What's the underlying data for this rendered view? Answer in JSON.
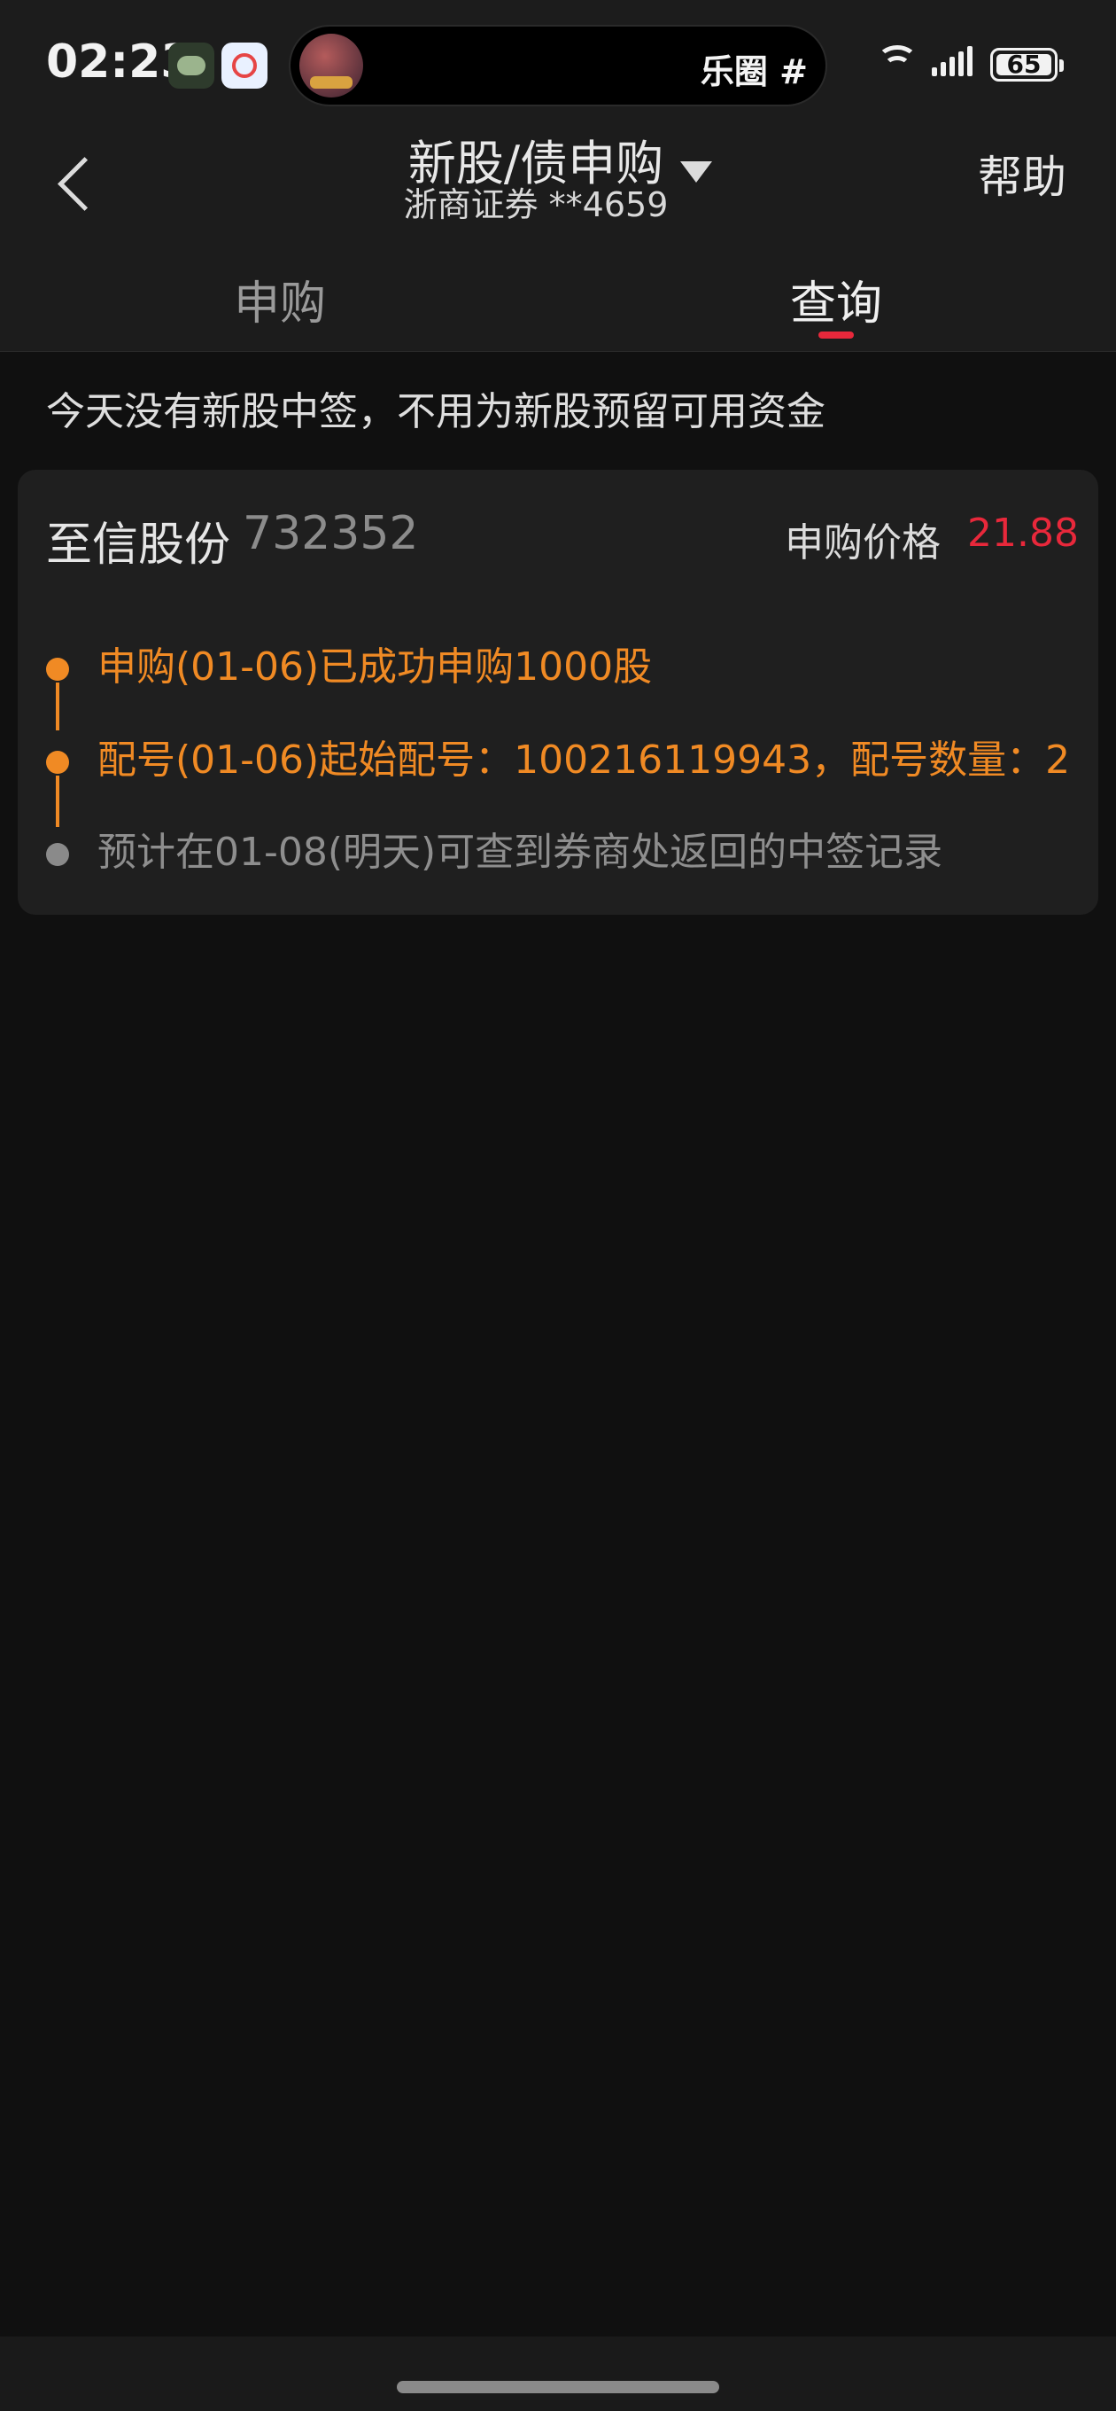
{
  "status_bar": {
    "time": "02:23",
    "notification_icons": [
      "game-app-icon",
      "finance-app-icon"
    ],
    "live_activity_text": "乐圈 #",
    "battery_level": "65",
    "icons": [
      "wifi-icon",
      "signal-icon",
      "battery-icon"
    ]
  },
  "nav": {
    "back_icon": "chevron-left-icon",
    "title": "新股/债申购",
    "account": "浙商证券 **4659",
    "dropdown_icon": "triangle-down-icon",
    "help_label": "帮助"
  },
  "tabs": [
    {
      "label": "申购",
      "active": false
    },
    {
      "label": "查询",
      "active": true
    }
  ],
  "notice": "今天没有新股中签，不用为新股预留可用资金",
  "record": {
    "stock_name": "至信股份",
    "stock_code": "732352",
    "price_label": "申购价格",
    "price": "21.88",
    "steps": [
      {
        "text": "申购(01-06)已成功申购1000股",
        "status": "done"
      },
      {
        "text": "配号(01-06)起始配号：100216119943，配号数量：2",
        "status": "done"
      },
      {
        "text": "预计在01-08(明天)可查到券商处返回的中签记录",
        "status": "pending"
      }
    ]
  },
  "colors": {
    "accent_red": "#e8283b",
    "progress_orange": "#f08a24",
    "pending_gray": "#8a8a8a",
    "background": "#101010",
    "card": "#1f1f1f"
  }
}
